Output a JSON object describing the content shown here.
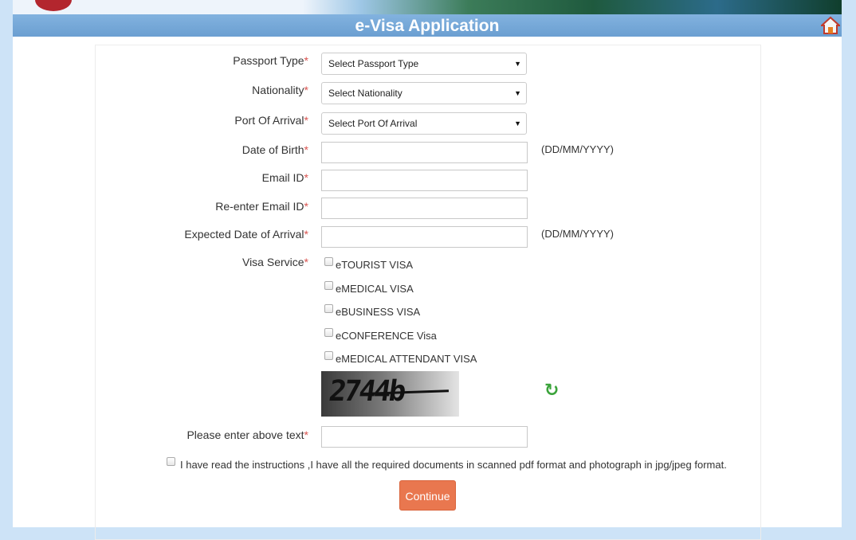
{
  "header": {
    "title": "e-Visa Application",
    "home_icon": "home-icon"
  },
  "form": {
    "passport_type": {
      "label": "Passport Type",
      "value": "Select Passport Type"
    },
    "nationality": {
      "label": "Nationality",
      "value": "Select Nationality"
    },
    "port_of_arrival": {
      "label": "Port Of Arrival",
      "value": "Select Port Of Arrival"
    },
    "date_of_birth": {
      "label": "Date of Birth",
      "hint": "(DD/MM/YYYY)"
    },
    "email": {
      "label": "Email ID"
    },
    "reenter_email": {
      "label": "Re-enter Email ID"
    },
    "expected_arrival": {
      "label": "Expected Date of Arrival",
      "hint": "(DD/MM/YYYY)"
    },
    "visa_service": {
      "label": "Visa Service",
      "options": [
        "eTOURIST VISA",
        "eMEDICAL VISA",
        "eBUSINESS VISA",
        "eCONFERENCE Visa",
        "eMEDICAL ATTENDANT VISA"
      ]
    },
    "captcha": {
      "text": "2744b",
      "refresh_icon": "refresh-icon"
    },
    "captcha_input": {
      "label": "Please enter above text"
    },
    "agreement": "I have read the instructions ,I have all the required documents in scanned pdf format and photograph in jpg/jpeg format.",
    "continue_label": "Continue",
    "required_mark": "*"
  }
}
